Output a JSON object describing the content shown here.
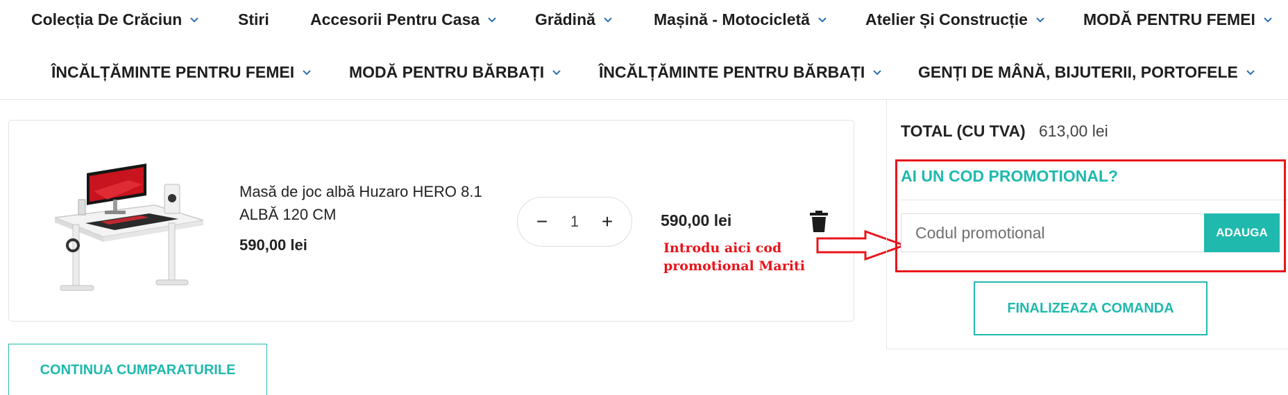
{
  "nav": {
    "row1": [
      {
        "label": "Colecția De Crăciun",
        "dropdown": true
      },
      {
        "label": "Stiri",
        "dropdown": false
      },
      {
        "label": "Accesorii Pentru Casa",
        "dropdown": true
      },
      {
        "label": "Grădină",
        "dropdown": true
      },
      {
        "label": "Mașină - Motocicletă",
        "dropdown": true
      },
      {
        "label": "Atelier Și Construcție",
        "dropdown": true
      },
      {
        "label": "MODĂ PENTRU FEMEI",
        "dropdown": true
      }
    ],
    "row2": [
      {
        "label": "ÎNCĂLȚĂMINTE PENTRU FEMEI",
        "dropdown": true
      },
      {
        "label": "MODĂ PENTRU BĂRBAȚI",
        "dropdown": true
      },
      {
        "label": "ÎNCĂLȚĂMINTE PENTRU BĂRBAȚI",
        "dropdown": true
      },
      {
        "label": "GENȚI DE MÂNĂ, BIJUTERII, PORTOFELE",
        "dropdown": true
      }
    ]
  },
  "cart": {
    "item": {
      "name": "Masă de joc albă Huzaro HERO 8.1 ALBĂ 120 CM",
      "unit_price": "590,00 lei",
      "quantity": "1",
      "decrease_label": "−",
      "increase_label": "+",
      "line_total": "590,00 lei",
      "delete_icon": "trash-icon"
    },
    "annotation": "Introdu aici cod promotional Mariti",
    "continue_label": "CONTINUA CUMPARATURILE"
  },
  "summary": {
    "total_label": "TOTAL (CU TVA)",
    "total_value": "613,00 lei",
    "promo_title": "AI UN COD PROMOTIONAL?",
    "promo_placeholder": "Codul promotional",
    "add_label": "ADAUGA",
    "finalize_label": "FINALIZEAZA COMANDA"
  },
  "colors": {
    "accent": "#1fb9ad",
    "annotation_red": "#e8141b",
    "text": "#222222"
  }
}
